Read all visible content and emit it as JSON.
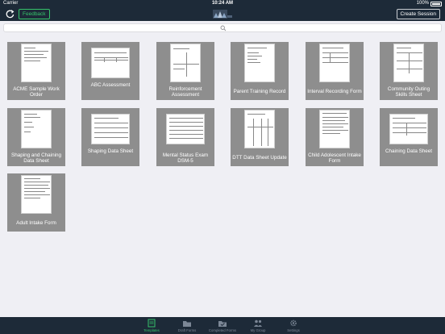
{
  "status_bar": {
    "carrier": "Carrier",
    "time": "10:24 AM",
    "battery": "100%"
  },
  "nav": {
    "feedback_label": "Feedback",
    "create_label": "Create Session"
  },
  "search": {
    "placeholder": ""
  },
  "templates": [
    {
      "label": "ACME Sample Work Order"
    },
    {
      "label": "ABC Assessment"
    },
    {
      "label": "Reinforcement Assessment"
    },
    {
      "label": "Parent Training Record"
    },
    {
      "label": "Interval Recording Form"
    },
    {
      "label": "Community Outing Skills Sheet"
    },
    {
      "label": "Shaping and Chaining Data Sheet"
    },
    {
      "label": "Shaping Data Sheet"
    },
    {
      "label": "Mental Status Exam DSM-5"
    },
    {
      "label": "DTT Data Sheet Update"
    },
    {
      "label": "Child Adolescent Intake Form"
    },
    {
      "label": "Chaining Data Sheet"
    },
    {
      "label": "Adult Intake Form"
    }
  ],
  "tabs": [
    {
      "label": "Templates",
      "active": true
    },
    {
      "label": "Draft Forms"
    },
    {
      "label": "Completed Forms"
    },
    {
      "label": "My Group"
    },
    {
      "label": "Settings"
    }
  ],
  "colors": {
    "bar": "#1d2a38",
    "accent": "#35c36a",
    "tile": "#8e8e8e",
    "background": "#efeff4"
  }
}
